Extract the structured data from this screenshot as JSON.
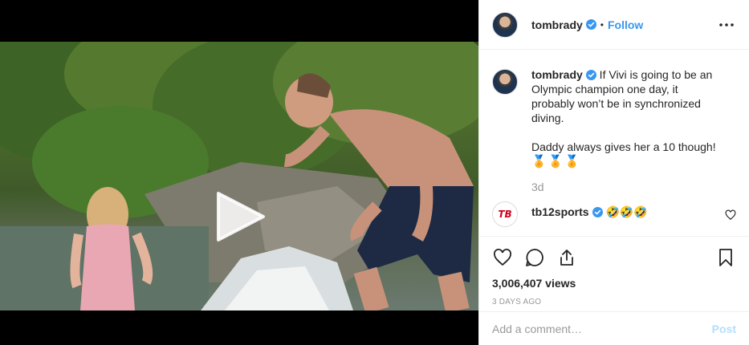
{
  "post": {
    "author": "tombrady",
    "follow_label": "Follow",
    "separator": "•",
    "more_icon": "more-horizontal-icon",
    "caption_text": " If Vivi is going to be an Olympic champion one day, it probably won’t be in synchronized diving.\n\nDaddy always gives her a 10 though!",
    "caption_emoji": "🏅🏅🏅",
    "time": "3d",
    "comment": {
      "author": "tb12sports",
      "text": " 🤣🤣🤣",
      "avatar_text": "TB"
    },
    "views": "3,006,407 views",
    "posted_ago": "3 DAYS AGO",
    "add_comment_placeholder": "Add a comment…",
    "post_label": "Post"
  },
  "colors": {
    "accent": "#3897f0",
    "verified": "#3897f0",
    "muted": "#999999",
    "post_disabled": "#b2dffc"
  },
  "icons": {
    "like": "heart-icon",
    "comment": "comment-icon",
    "share": "share-icon",
    "save": "bookmark-icon",
    "play": "play-icon"
  }
}
